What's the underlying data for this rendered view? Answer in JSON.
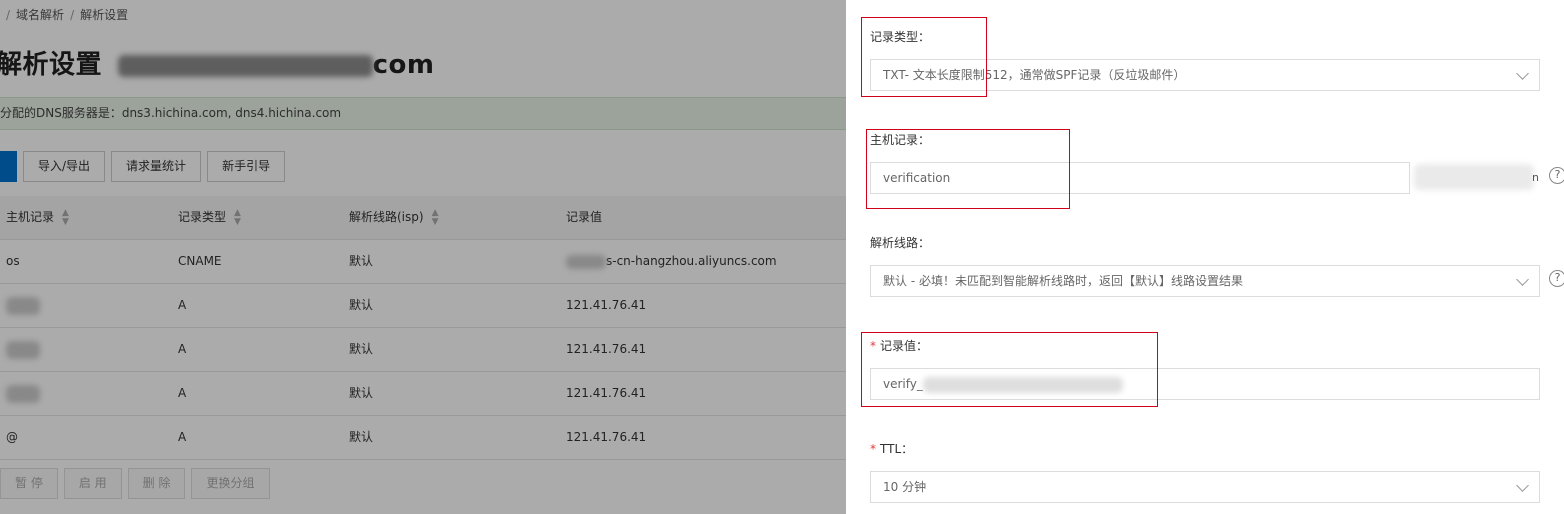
{
  "breadcrumb": {
    "item1": "域名解析",
    "item2": "解析设置"
  },
  "title": {
    "prefix": "解析设置",
    "domain_suffix": "com"
  },
  "dns_info": "分配的DNS服务器是：dns3.hichina.com, dns4.hichina.com",
  "toolbar": {
    "import_export": "导入/导出",
    "request_stats": "请求量统计",
    "guide": "新手引导",
    "primary_label": ""
  },
  "table": {
    "headers": [
      "主机记录",
      "记录类型",
      "解析线路(isp)",
      "记录值"
    ],
    "rows": [
      [
        "os",
        "CNAME",
        "默认",
        "s-cn-hangzhou.aliyuncs.com"
      ],
      [
        "",
        "A",
        "默认",
        "121.41.76.41"
      ],
      [
        "",
        "A",
        "默认",
        "121.41.76.41"
      ],
      [
        "",
        "A",
        "默认",
        "121.41.76.41"
      ],
      [
        "@",
        "A",
        "默认",
        "121.41.76.41"
      ]
    ]
  },
  "bottom_actions": {
    "pause": "暂 停",
    "enable": "启 用",
    "delete": "删 除",
    "change_group": "更换分组"
  },
  "form": {
    "record_type": {
      "label": "记录类型：",
      "value": "TXT- 文本长度限制512，通常做SPF记录（反垃圾邮件）"
    },
    "host_record": {
      "label": "主机记录：",
      "value": "verification",
      "suffix": "n"
    },
    "line": {
      "label": "解析线路：",
      "value": "默认 - 必填！未匹配到智能解析线路时，返回【默认】线路设置结果"
    },
    "record_value": {
      "label": "记录值：",
      "value": "verify_"
    },
    "ttl": {
      "label": "TTL：",
      "value": "10 分钟"
    },
    "required_mark": "*",
    "help_glyph": "?"
  }
}
